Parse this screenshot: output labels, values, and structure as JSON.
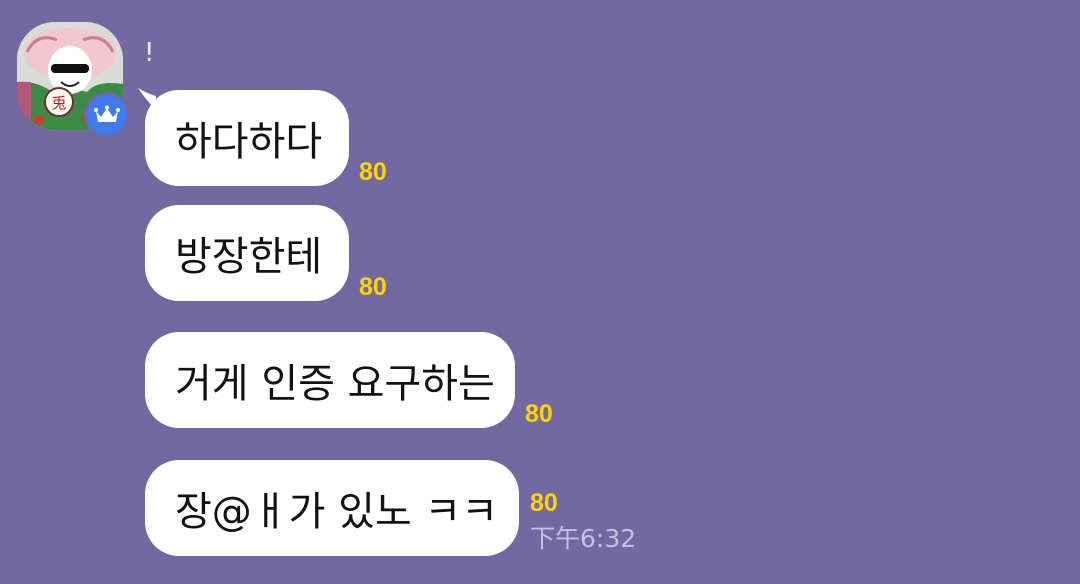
{
  "sender": {
    "name": "!",
    "avatar_icon": "rabbit-master-avatar",
    "badge_icon": "crown-icon",
    "badge_color": "#3f7bf0"
  },
  "theme": {
    "background": "#7268a2",
    "bubble": "#ffffff",
    "unread_color": "#ffd400"
  },
  "messages": [
    {
      "text": "하다하다",
      "unread": "80"
    },
    {
      "text": "방장한테",
      "unread": "80"
    },
    {
      "text": "거게 인증 요구하는",
      "unread": "80"
    },
    {
      "text": "장@ㅐ가 있노 ㅋㅋ",
      "unread": "80",
      "time": "下午6:32"
    }
  ]
}
